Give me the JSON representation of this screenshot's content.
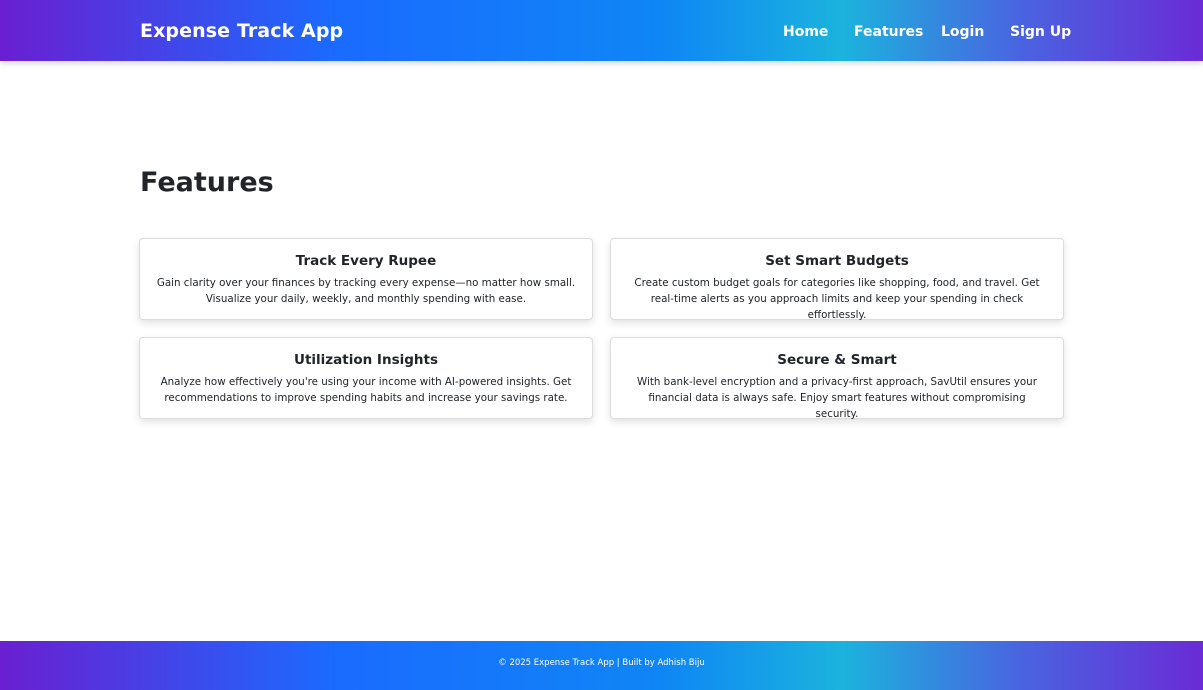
{
  "navbar": {
    "brand": "Expense Track App",
    "links": [
      {
        "label": "Home"
      },
      {
        "label": "Features"
      },
      {
        "label": "Login"
      },
      {
        "label": "Sign Up"
      }
    ]
  },
  "main": {
    "title": "Features",
    "cards": [
      {
        "title": "Track Every Rupee",
        "text": "Gain clarity over your finances by tracking every expense—no matter how small. Visualize your daily, weekly, and monthly spending with ease."
      },
      {
        "title": "Set Smart Budgets",
        "text": "Create custom budget goals for categories like shopping, food, and travel. Get real-time alerts as you approach limits and keep your spending in check effortlessly."
      },
      {
        "title": "Utilization Insights",
        "text": "Analyze how effectively you're using your income with AI-powered insights. Get recommendations to improve spending habits and increase your savings rate."
      },
      {
        "title": "Secure & Smart",
        "text": "With bank-level encryption and a privacy-first approach, SavUtil ensures your financial data is always safe. Enjoy smart features without compromising security."
      }
    ]
  },
  "footer": {
    "text": "© 2025 Expense Track App | Built by Adhish Biju"
  },
  "colors": {
    "gradient_start": "#6a1fd1",
    "gradient_mid": "#1a6bff",
    "gradient_cyan": "#1bb3dd",
    "gradient_end": "#6a2bd6",
    "text": "#212529"
  }
}
